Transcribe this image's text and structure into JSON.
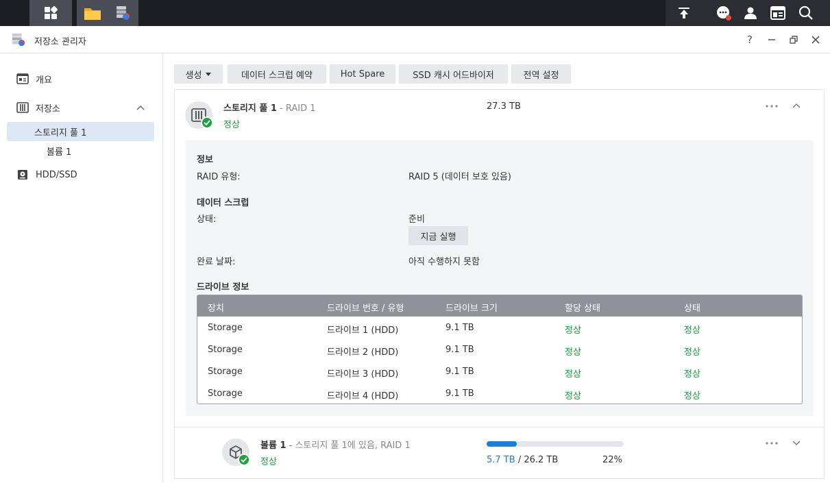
{
  "window": {
    "title": "저장소 관리자"
  },
  "sidebar": {
    "items": [
      {
        "label": "개요"
      },
      {
        "label": "저장소"
      },
      {
        "label": "스토리지 풀 1"
      },
      {
        "label": "볼륨 1"
      },
      {
        "label": "HDD/SSD"
      }
    ]
  },
  "toolbar": {
    "create_label": "생성",
    "scrub_schedule_label": "데이터 스크럽 예약",
    "hot_spare_label": "Hot Spare",
    "ssd_advisor_label": "SSD 캐시 어드바이저",
    "global_settings_label": "전역 설정"
  },
  "pool": {
    "name": "스토리지 풀 1",
    "raid_suffix": "- RAID 1",
    "status": "정상",
    "capacity": "27.3 TB",
    "info_heading": "정보",
    "raid_type_label": "RAID 유형:",
    "raid_type_value": "RAID 5 (데이터 보호 있음)",
    "scrub_heading": "데이터 스크럽",
    "scrub_status_label": "상태:",
    "scrub_status_value": "준비",
    "run_now_label": "지금 실행",
    "completion_label": "완료 날짜:",
    "completion_value": "아직 수행하지 못함",
    "drive_heading": "드라이브 정보",
    "table": {
      "headers": [
        "장치",
        "드라이브 번호 / 유형",
        "드라이브 크기",
        "할당 상태",
        "상태"
      ],
      "rows": [
        [
          "Storage",
          "드라이브 1 (HDD)",
          "9.1 TB",
          "정상",
          "정상"
        ],
        [
          "Storage",
          "드라이브 2 (HDD)",
          "9.1 TB",
          "정상",
          "정상"
        ],
        [
          "Storage",
          "드라이브 3 (HDD)",
          "9.1 TB",
          "정상",
          "정상"
        ],
        [
          "Storage",
          "드라이브 4 (HDD)",
          "9.1 TB",
          "정상",
          "정상"
        ]
      ]
    }
  },
  "volume": {
    "name": "볼륨 1",
    "sub": "- 스토리지 풀 1에 있음, RAID 1",
    "status": "정상",
    "used": "5.7 TB",
    "total": "/ 26.2 TB",
    "percent": "22%",
    "usage_fraction": 0.22
  },
  "colors": {
    "accent": "#1d7ed8",
    "ok": "#1e9b3a",
    "badge": "#e64a3c"
  }
}
